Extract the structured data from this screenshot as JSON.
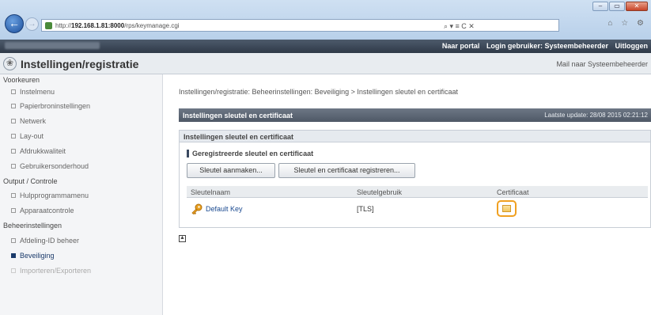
{
  "browser": {
    "url_prefix": "http://",
    "url_host": "192.168.1.81:8000",
    "url_path": "/rps/keymanage.cgi",
    "addr_tools": "⌕ ▾ ≡ C ✕",
    "toolbar_icons": "⌂ ☆ ⚙",
    "win_min": "–",
    "win_max": "▭",
    "win_close": "✕",
    "back_glyph": "←",
    "fwd_glyph": "→"
  },
  "topbar": {
    "portal_link": "Naar portal",
    "login_user": "Login gebruiker: Systeembeheerder",
    "logout": "Uitloggen"
  },
  "header": {
    "logo_glyph": "❀",
    "title": "Instellingen/registratie",
    "mail_link": "Mail naar Systeembeheerder"
  },
  "sidebar": {
    "sections": [
      {
        "heading": "Voorkeuren",
        "items": [
          "Instelmenu",
          "Papierbroninstellingen",
          "Netwerk",
          "Lay-out",
          "Afdrukkwaliteit",
          "Gebruikersonderhoud"
        ]
      },
      {
        "heading": "Output / Controle",
        "items": [
          "Hulpprogrammamenu",
          "Apparaatcontrole"
        ]
      },
      {
        "heading": "Beheerinstellingen",
        "items": [
          "Afdeling-ID beheer",
          "Beveiliging",
          "Importeren/Exporteren"
        ]
      }
    ]
  },
  "main": {
    "breadcrumb": "Instellingen/registratie: Beheerinstellingen: Beveiliging > Instellingen sleutel en certificaat",
    "page_title": "Instellingen sleutel en certificaat",
    "last_update": "Laatste update: 28/08 2015 02:21:12",
    "panel_title": "Instellingen sleutel en certificaat",
    "sub_title": "Geregistreerde sleutel en certificaat",
    "btn_create": "Sleutel aanmaken...",
    "btn_register": "Sleutel en certificaat registreren...",
    "table": {
      "headers": [
        "Sleutelnaam",
        "Sleutelgebruik",
        "Certificaat"
      ],
      "rows": [
        {
          "key_name": "Default Key",
          "usage": "[TLS]"
        }
      ]
    },
    "top_glyph": "▲"
  },
  "colors": {
    "highlight": "#f0a020",
    "link": "#1a4a90",
    "header_dark": "#2f3a48"
  }
}
